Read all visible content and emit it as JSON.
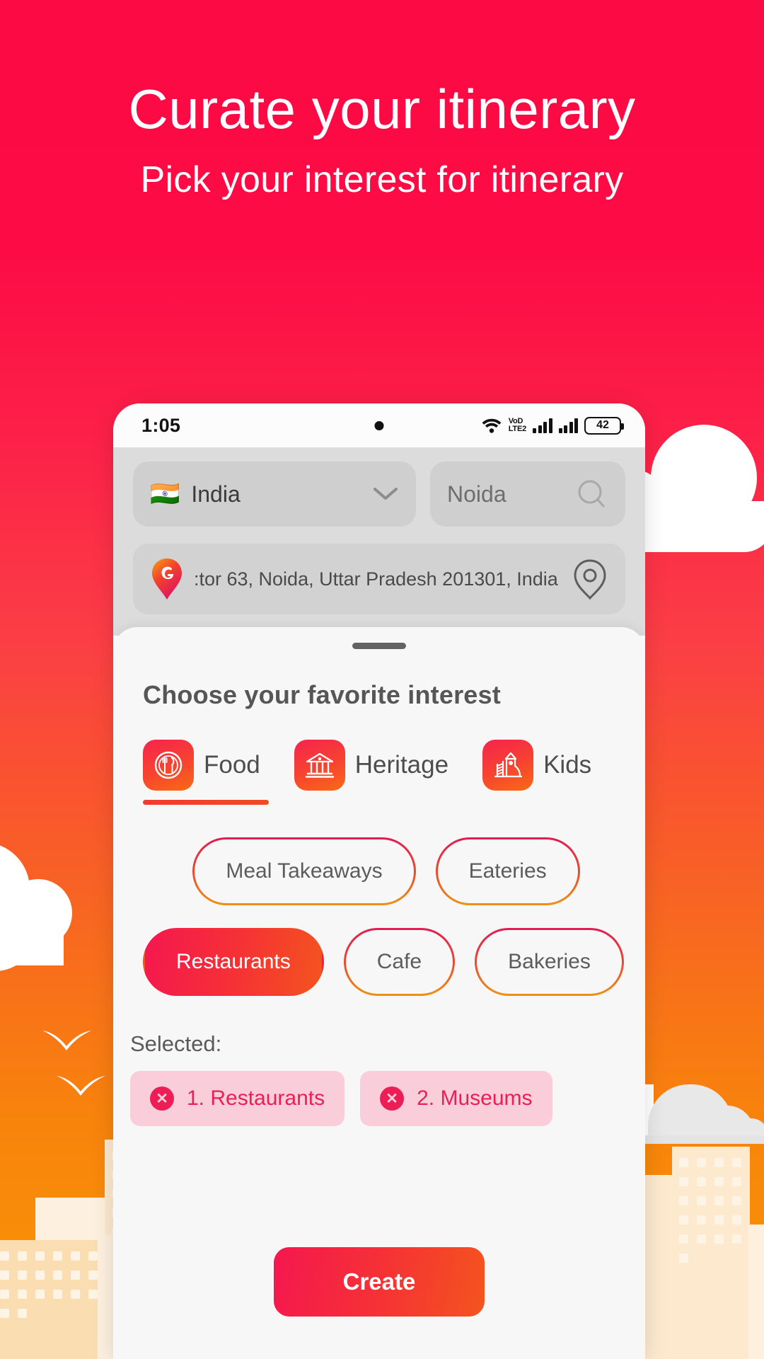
{
  "hero": {
    "title": "Curate your itinerary",
    "subtitle": "Pick your interest for itinerary"
  },
  "status_bar": {
    "time": "1:05",
    "volte_top": "VoD",
    "volte_bottom": "LTE2",
    "battery": "42",
    "wifi_icon": "wifi-icon",
    "signal_icon": "signal-bars-icon",
    "camera_icon": "camera-punch-hole"
  },
  "search": {
    "country_flag": "🇮🇳",
    "country": "India",
    "country_chevron": "chevron-down-icon",
    "city": "Noida",
    "city_search_icon": "search-icon",
    "address": ":tor 63, Noida, Uttar Pradesh 201301, India",
    "address_pin_icon": "g-map-pin-icon",
    "locate_icon": "current-location-icon"
  },
  "sheet": {
    "title": "Choose your favorite interest",
    "tabs": [
      {
        "label": "Food",
        "icon": "food-plate-cutlery-icon",
        "active": true
      },
      {
        "label": "Heritage",
        "icon": "heritage-museum-icon",
        "active": false
      },
      {
        "label": "Kids",
        "icon": "kids-playground-slide-icon",
        "active": false
      }
    ],
    "chip_rows": [
      [
        {
          "label": "Meal Takeaways",
          "selected": false
        },
        {
          "label": "Eateries",
          "selected": false
        }
      ],
      [
        {
          "label": "Restaurants",
          "selected": true
        },
        {
          "label": "Cafe",
          "selected": false
        },
        {
          "label": "Bakeries",
          "selected": false
        }
      ]
    ],
    "selected_label": "Selected:",
    "selected_items": [
      {
        "text": "1. Restaurants",
        "remove_icon": "close-circle-icon"
      },
      {
        "text": "2. Museums",
        "remove_icon": "close-circle-icon"
      }
    ],
    "create_label": "Create"
  },
  "colors": {
    "brand_crimson": "#F5174F",
    "brand_orange": "#F4541E",
    "sky_top": "#FB0A43",
    "sky_bottom": "#F89406",
    "selected_chip_bg": "#F9CEDA",
    "selected_chip_text": "#EC1E55",
    "building": "#FBDDB2"
  }
}
